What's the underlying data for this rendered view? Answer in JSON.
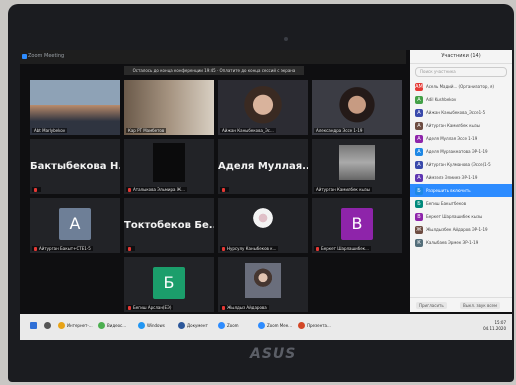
{
  "window": {
    "title": "Zoom Meeting",
    "banner": "Осталось до конца конференции 19:45 · Оплатите до конца сессий с экрана"
  },
  "tiles": [
    {
      "id": "t1",
      "name": "Abt Marlybekov",
      "kind": "photo",
      "photo": "man-gray"
    },
    {
      "id": "t2",
      "name": "Кар РТ Мамбетов",
      "kind": "photo",
      "photo": "room"
    },
    {
      "id": "t3",
      "name": "Айжан Каныбекова_Эс...",
      "kind": "photo",
      "photo": "girl",
      "active": true
    },
    {
      "id": "t4",
      "name": "Александра Эссе 1-19",
      "kind": "photo",
      "photo": "girl2"
    },
    {
      "id": "t5",
      "big": "Бактыбекова Н...",
      "kind": "name",
      "muted": true,
      "name": ""
    },
    {
      "id": "t6",
      "name": "Аталыкова Эльмира Ж...",
      "kind": "dark",
      "muted": true
    },
    {
      "id": "t7",
      "big": "Аделя Муллая...",
      "kind": "name",
      "muted": true,
      "name": ""
    },
    {
      "id": "t8",
      "name": "Айтурган Камилбек кызы",
      "kind": "photo",
      "photo": "grey"
    },
    {
      "id": "t9",
      "name": "Айтурган Бакыт+СТЕ1-5",
      "kind": "avatar",
      "letter": "А",
      "color": "#6e7f97",
      "muted": true
    },
    {
      "id": "t10",
      "big": "Токтобеков Бе...",
      "kind": "name",
      "muted": true,
      "name": ""
    },
    {
      "id": "t11",
      "name": "Нурсулу Каныбеков к...",
      "kind": "photo",
      "photo": "pic",
      "muted": true
    },
    {
      "id": "t12",
      "name": "Беркет Шарлашибек...",
      "kind": "avatar",
      "letter": "В",
      "color": "#8e24aa",
      "muted": true
    },
    {
      "id": "t13",
      "name": "Бегиш Арслан(ЕЭ)",
      "kind": "avatar",
      "letter": "Б",
      "color": "#1b9e6b",
      "muted": true
    },
    {
      "id": "t14",
      "name": "Жылдыз Айдарова",
      "kind": "photo",
      "photo": "girl3",
      "muted": true
    }
  ],
  "panel": {
    "title": "Участники (14)",
    "search_placeholder": "Поиск участника",
    "participants": [
      {
        "name": "Асель Мадий... (Организатор, я)",
        "letter": "АМ",
        "color": "#e53935"
      },
      {
        "name": "Adil Kushbekov",
        "letter": "A",
        "color": "#43a047"
      },
      {
        "name": "Айжан Каныбекова_Эссе1-5",
        "letter": "А",
        "color": "#3949ab"
      },
      {
        "name": "Айтурган Камилбек кызы",
        "letter": "А",
        "color": "#6d4c41"
      },
      {
        "name": "Аделя Муллая Эссе 1-19",
        "letter": "А",
        "color": "#8e24aa"
      },
      {
        "name": "Аделя Мурзакматова ЭР-1-19",
        "letter": "А",
        "color": "#1e88e5"
      },
      {
        "name": "Айтурган Кулманова (Эссе)1-5",
        "letter": "А",
        "color": "#3949ab"
      },
      {
        "name": "Аймээлэ Элмиеэ ЭР-1-19",
        "letter": "А",
        "color": "#5e35b1"
      },
      {
        "name": "Разрешить включить",
        "letter": "Б",
        "color": "#1e88e5",
        "highlight": true
      },
      {
        "name": "Бегиш Бакытбеков",
        "letter": "Б",
        "color": "#00897b"
      },
      {
        "name": "Беркет Шарлашибек кызы",
        "letter": "В",
        "color": "#8e24aa"
      },
      {
        "name": "Жылдызбек Айдаров ЭР-1-19",
        "letter": "Ж",
        "color": "#6d4c41"
      },
      {
        "name": "Калыбаев Эрмек ЭР-1-19",
        "letter": "К",
        "color": "#546e7a"
      }
    ],
    "invite": "Пригласить",
    "mute_all": "Выкл. звук всем"
  },
  "taskbar": {
    "items": [
      {
        "label": "",
        "color": "#2f6fd6"
      },
      {
        "label": "",
        "color": "#555"
      },
      {
        "label": "Интернет-...",
        "color": "#e8a317"
      },
      {
        "label": "Видеос...",
        "color": "#4caf50"
      },
      {
        "label": "Windows",
        "color": "#2196f3"
      },
      {
        "label": "Документ",
        "color": "#2b579a"
      },
      {
        "label": "Zoom",
        "color": "#2d8cff"
      },
      {
        "label": "Zoom Mee...",
        "color": "#2d8cff"
      },
      {
        "label": "Презента...",
        "color": "#d24726"
      }
    ],
    "time": "15:07",
    "date": "04.11.2020"
  },
  "brand": "ASUS"
}
